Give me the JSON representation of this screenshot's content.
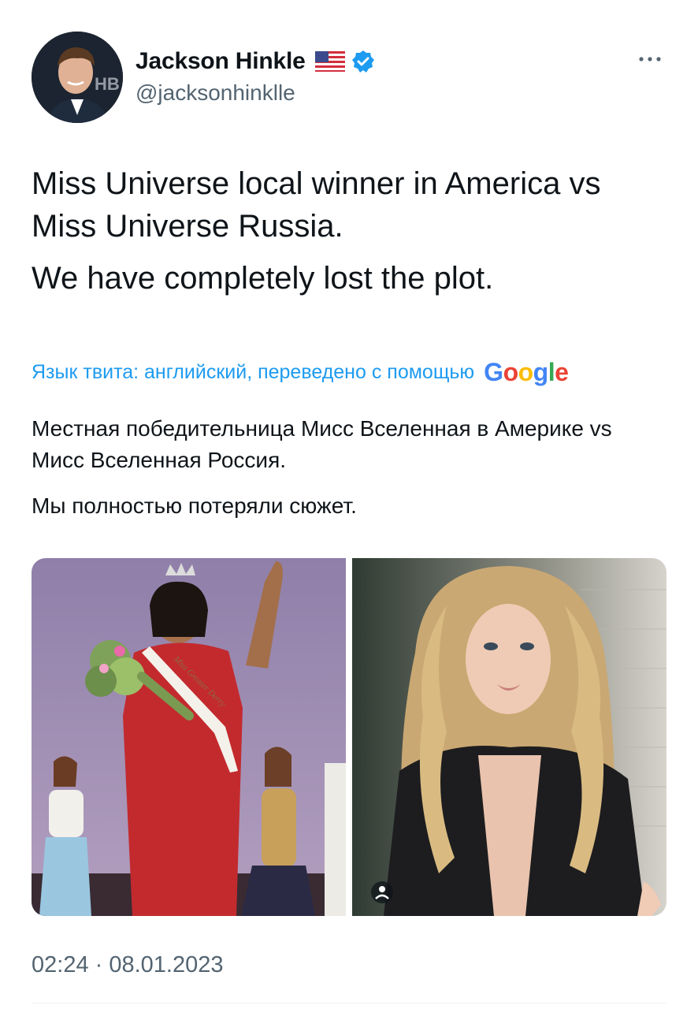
{
  "author": {
    "display_name": "Jackson Hinkle",
    "handle": "@jacksonhinklle",
    "flag_icon": "us-flag-icon",
    "verified_icon": "verified-badge-icon",
    "verified_color": "#1d9bf0"
  },
  "tweet": {
    "paragraphs": [
      "Miss Universe local winner in America vs Miss Universe Russia.",
      "We have completely lost the plot."
    ]
  },
  "translation": {
    "label": "Язык твита: английский, переведено с помощью",
    "provider": "Google",
    "paragraphs": [
      "Местная победительница Мисс Вселенная в Америке vs Мисс Вселенная Россия.",
      "Мы полностью потеряли сюжет."
    ]
  },
  "media": {
    "images": [
      {
        "sash_text": "Miss Greater Derry"
      },
      {}
    ]
  },
  "meta": {
    "timestamp": "02:24 · 08.01.2023"
  },
  "colors": {
    "text_primary": "#0f1419",
    "text_secondary": "#536471",
    "accent": "#1d9bf0"
  }
}
